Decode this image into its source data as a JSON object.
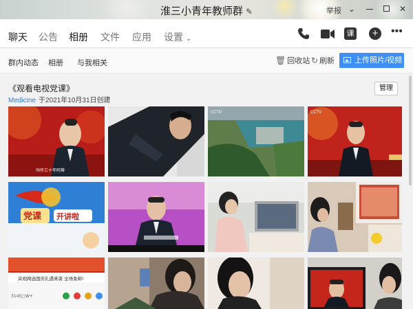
{
  "window": {
    "title": "淮三小青年教师群",
    "report_label": "举报"
  },
  "nav": {
    "tabs": [
      "聊天",
      "公告",
      "相册",
      "文件",
      "应用",
      "设置"
    ],
    "active_tab": "相册",
    "icons": [
      "phone-icon",
      "video-call-icon",
      "class-icon",
      "add-icon",
      "more-icon"
    ],
    "class_label": "课"
  },
  "subnav": {
    "items": [
      "群内动态",
      "相册",
      "与我相关"
    ],
    "recycle_label": "回收站",
    "refresh_label": "刷新",
    "upload_label": "上传照片/视频"
  },
  "album": {
    "title": "《观看电视党课》",
    "author": "Medicine",
    "created": "于2021年10月31日创建",
    "manage_label": "管理"
  },
  "photos": {
    "captions": {
      "p1": "叫作三十年阿蒂",
      "p5_title": "党课",
      "p5_sub": "开讲啦",
      "p10_ad": "央视网选国庆礼遇来袭 全场免邮!",
      "p10_code": "3145□W+"
    }
  },
  "colors": {
    "accent": "#3d8ff5",
    "link": "#2f7bd6",
    "red_stage": "#b81d1a"
  }
}
